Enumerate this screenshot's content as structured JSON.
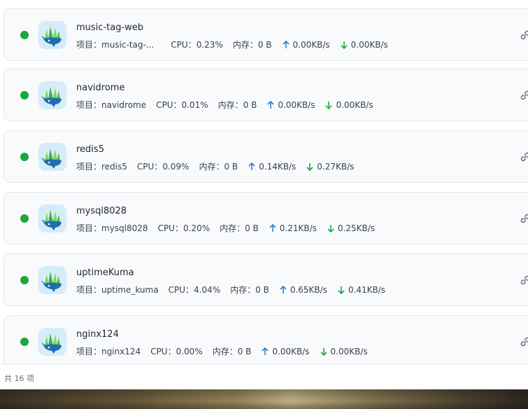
{
  "containers": [
    {
      "name": "music-tag-web",
      "project_label": "项目：",
      "project": "music-tag-...",
      "cpu_label": "CPU：",
      "cpu": "0.23%",
      "mem_label": "内存：",
      "mem": "0 B",
      "up": "0.00KB/s",
      "down": "0.00KB/s"
    },
    {
      "name": "navidrome",
      "project_label": "项目：",
      "project": "navidrome",
      "cpu_label": "CPU：",
      "cpu": "0.01%",
      "mem_label": "内存：",
      "mem": "0 B",
      "up": "0.00KB/s",
      "down": "0.00KB/s"
    },
    {
      "name": "redis5",
      "project_label": "项目：",
      "project": "redis5",
      "cpu_label": "CPU：",
      "cpu": "0.09%",
      "mem_label": "内存：",
      "mem": "0 B",
      "up": "0.14KB/s",
      "down": "0.27KB/s"
    },
    {
      "name": "mysql8028",
      "project_label": "项目：",
      "project": "mysql8028",
      "cpu_label": "CPU：",
      "cpu": "0.20%",
      "mem_label": "内存：",
      "mem": "0 B",
      "up": "0.21KB/s",
      "down": "0.25KB/s"
    },
    {
      "name": "uptimeKuma",
      "project_label": "项目：",
      "project": "uptime_kuma",
      "cpu_label": "CPU：",
      "cpu": "4.04%",
      "mem_label": "内存：",
      "mem": "0 B",
      "up": "0.65KB/s",
      "down": "0.41KB/s"
    },
    {
      "name": "nginx124",
      "project_label": "项目：",
      "project": "nginx124",
      "cpu_label": "CPU：",
      "cpu": "0.00%",
      "mem_label": "内存：",
      "mem": "0 B",
      "up": "0.00KB/s",
      "down": "0.00KB/s"
    }
  ],
  "footer": {
    "total": "共 16 项"
  },
  "icons": {
    "status": "running-status-dot",
    "app": "docker-whale-icon",
    "upload": "arrow-up-icon",
    "download": "arrow-down-icon",
    "action": "link-icon"
  },
  "colors": {
    "running": "#19a83b",
    "upload": "#2b7fd6",
    "download": "#19a83b"
  }
}
